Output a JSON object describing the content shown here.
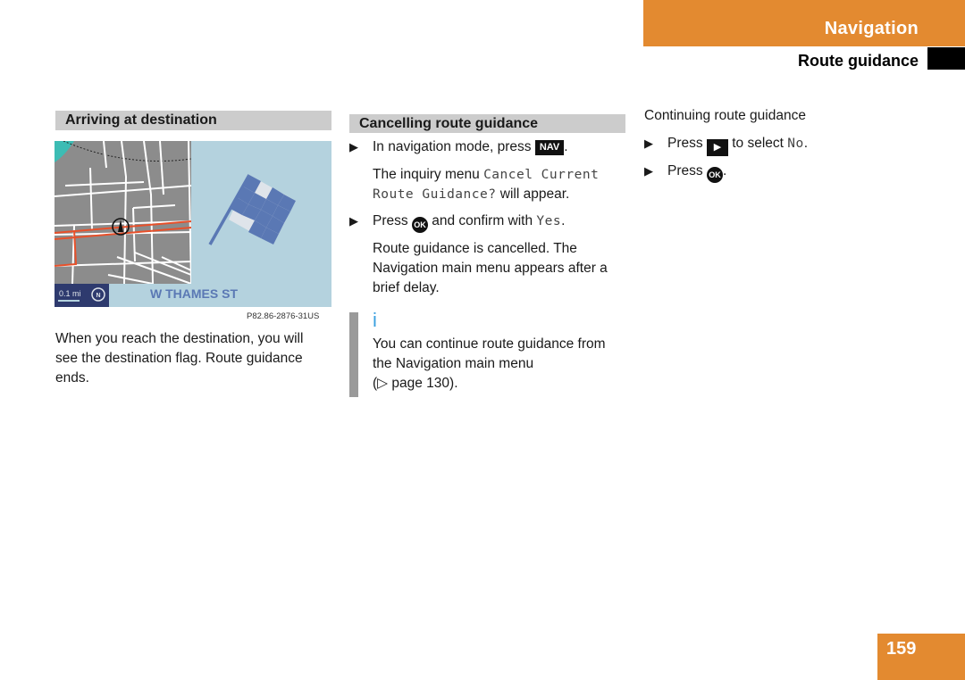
{
  "header": {
    "chapter": "Navigation",
    "section": "Route guidance"
  },
  "colors": {
    "accent": "#e38a30",
    "heading_bg": "#cccccc",
    "map_bg": "#8c8c8c",
    "panel_bg": "#b4d2de",
    "flag_blue": "#5a78b4",
    "route_red": "#e8502a",
    "info_blue": "#3ba0e0"
  },
  "left_column": {
    "heading": "Arriving at destination",
    "figure": {
      "scale_label": "0.1 mi",
      "compass_icon": "north-compass-icon",
      "street_name": "W THAMES ST",
      "flag_icon": "checkered-flag-icon",
      "figure_code": "P82.86-2876-31US"
    },
    "paragraph": [
      "When you reach the destination, you will",
      "see the destination flag. Route guidance",
      "ends."
    ]
  },
  "middle_column": {
    "heading": "Cancelling route guidance",
    "step1": {
      "text": "In navigation mode, press",
      "key": "NAV",
      "suffix": "."
    },
    "result1": {
      "prefix": "The inquiry menu",
      "mono_1": "Cancel Current",
      "mono_2": "Route Guidance?",
      "suffix": "will appear."
    },
    "step2": {
      "prefix": "Press",
      "key": "OK",
      "middle": "and confirm with",
      "mono": "Yes",
      "suffix": "."
    },
    "result2": [
      "Route guidance is cancelled. The",
      "Navigation main menu appears after a",
      "brief delay."
    ],
    "info": {
      "icon": "i",
      "lines": [
        "You can continue route guidance from",
        "the Navigation main menu",
        "(▷ page 130)."
      ]
    }
  },
  "right_column": {
    "heading": "Continuing route guidance",
    "step1": {
      "prefix": "Press",
      "key": "▶",
      "middle": "to select",
      "mono": "No",
      "suffix": "."
    },
    "step2": {
      "prefix": "Press",
      "key": "OK",
      "suffix": "."
    }
  },
  "bullet_glyph": "▶",
  "page_number": "159"
}
